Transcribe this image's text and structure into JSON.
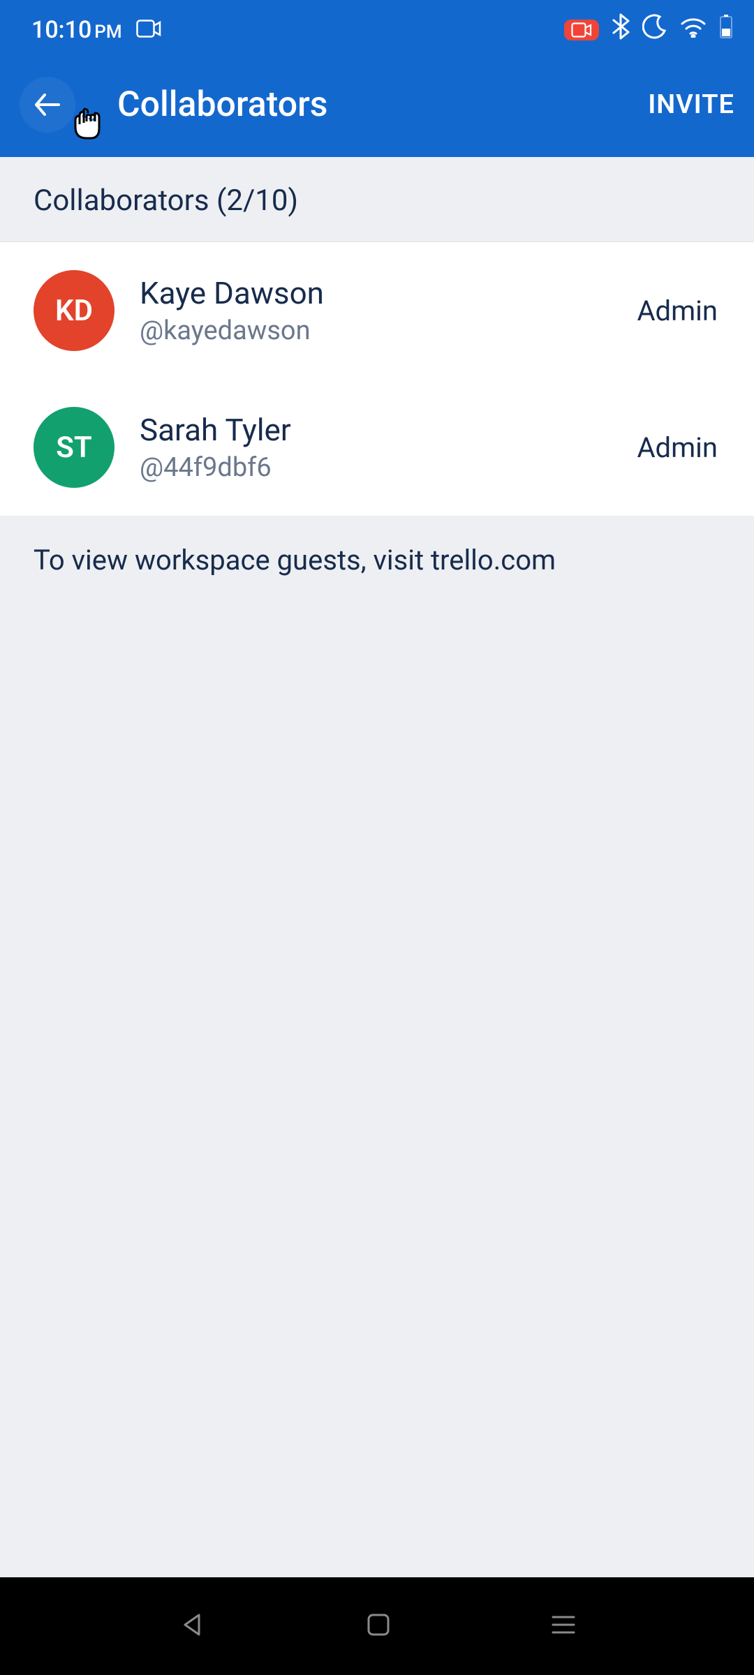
{
  "status": {
    "time": "10:10",
    "ampm": "PM"
  },
  "appbar": {
    "title": "Collaborators",
    "invite": "INVITE"
  },
  "section": {
    "header": "Collaborators (2/10)"
  },
  "collaborators": [
    {
      "initials": "KD",
      "name": "Kaye Dawson",
      "handle": "@kayedawson",
      "role": "Admin"
    },
    {
      "initials": "ST",
      "name": "Sarah Tyler",
      "handle": "@44f9dbf6",
      "role": "Admin"
    }
  ],
  "note": "To view workspace guests, visit trello.com"
}
